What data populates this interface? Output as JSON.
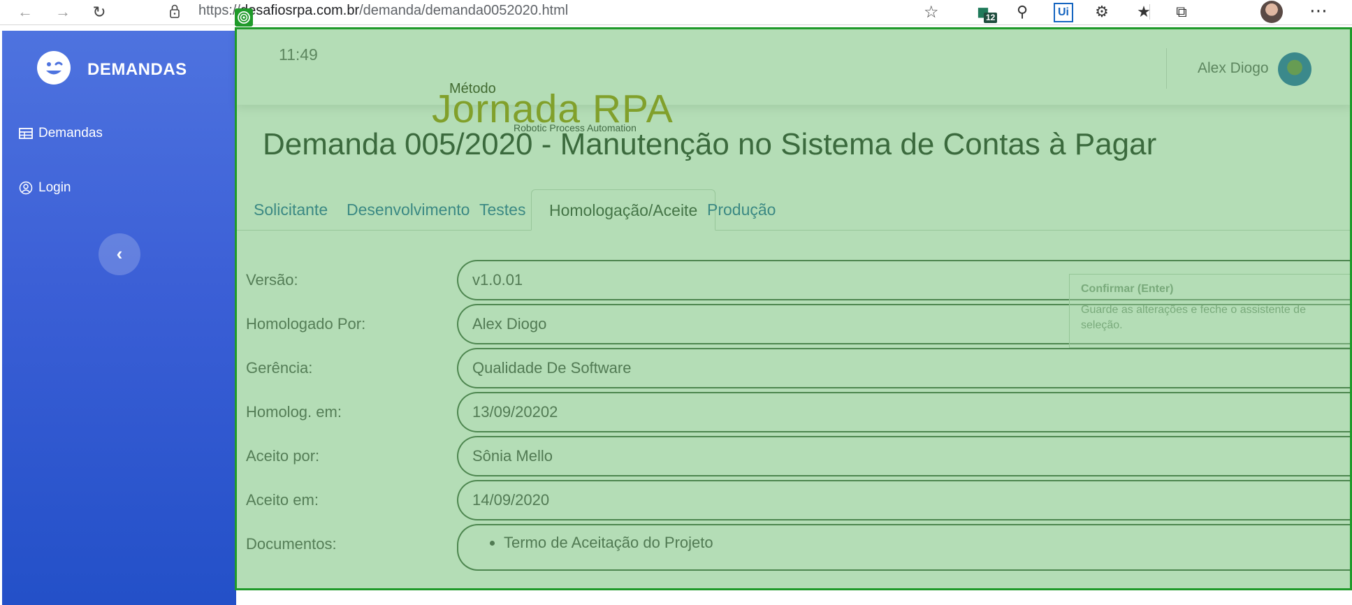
{
  "browser": {
    "url_prefix": "https://",
    "url_host": "desafiosrpa.com.br",
    "url_path": "/demanda/demanda0052020.html",
    "extension_badge": "12",
    "ui_extension_label": "Ui"
  },
  "sidebar": {
    "brand": "DEMANDAS",
    "items": [
      {
        "label": "Demandas",
        "icon": "table-icon"
      },
      {
        "label": "Login",
        "icon": "user-circle-icon"
      }
    ],
    "toggle_icon": "‹"
  },
  "topbar": {
    "time": "11:49",
    "user_name": "Alex Diogo"
  },
  "logo": {
    "metodo": "Método",
    "main": "Jornada RPA",
    "sub": "Robotic Process Automation"
  },
  "page": {
    "title": "Demanda 005/2020 - Manutenção no Sistema de Contas à Pagar"
  },
  "tabs": [
    {
      "label": "Solicitante",
      "active": false
    },
    {
      "label": "Desenvolvimento",
      "active": false
    },
    {
      "label": "Testes",
      "active": false
    },
    {
      "label": "Homologação/Aceite",
      "active": true
    },
    {
      "label": "Produção",
      "active": false
    }
  ],
  "form": {
    "fields": [
      {
        "label": "Versão:",
        "value": "v1.0.01"
      },
      {
        "label": "Homologado Por:",
        "value": "Alex Diogo"
      },
      {
        "label": "Gerência:",
        "value": "Qualidade De Software"
      },
      {
        "label": "Homolog. em:",
        "value": "13/09/20202"
      },
      {
        "label": "Aceito por:",
        "value": "Sônia Mello"
      },
      {
        "label": "Aceito em:",
        "value": "14/09/2020"
      }
    ],
    "documents_label": "Documentos:",
    "documents": [
      "Termo de Aceitação do Projeto"
    ]
  },
  "tooltip": {
    "title": "Confirmar (Enter)",
    "body": "Guarde as alterações e feche o assistente de seleção."
  },
  "colors": {
    "sidebar_top": "#4e73df",
    "sidebar_bottom": "#2350c8",
    "overlay": "#4caf50",
    "tab_link": "#2f6ea8",
    "logo": "#a89610"
  }
}
